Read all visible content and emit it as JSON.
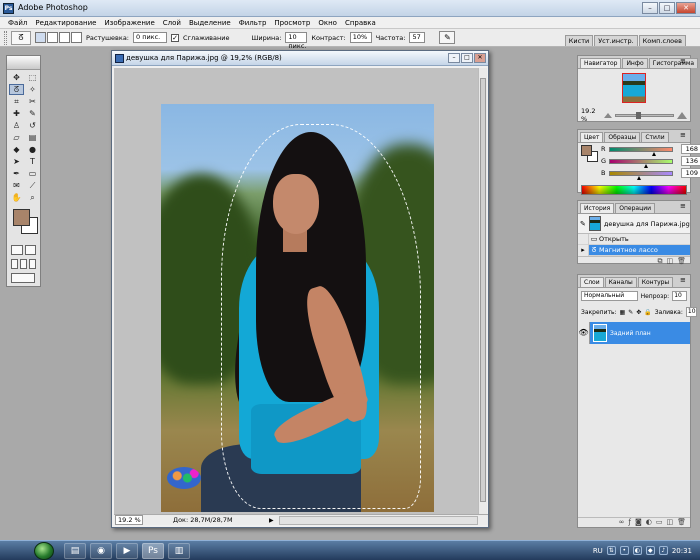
{
  "app": {
    "title": "Adobe Photoshop"
  },
  "menu": [
    "Файл",
    "Редактирование",
    "Изображение",
    "Слой",
    "Выделение",
    "Фильтр",
    "Просмотр",
    "Окно",
    "Справка"
  ],
  "options": {
    "feather_label": "Растушевка:",
    "feather_value": "0 пикс.",
    "antialias_label": "Сглаживание",
    "antialias_checked": true,
    "width_label": "Ширина:",
    "width_value": "10 пикс.",
    "contrast_label": "Контраст:",
    "contrast_value": "10%",
    "frequency_label": "Частота:",
    "frequency_value": "57"
  },
  "palette_well": [
    "Кисти",
    "Уст.инстр.",
    "Комп.слоев"
  ],
  "toolbox": {
    "foreground_color": "#a8846a",
    "background_color": "#ffffff",
    "tools": [
      "move-icon",
      "marquee-icon",
      "lasso-icon",
      "magic-wand-icon",
      "crop-icon",
      "slice-icon",
      "healing-icon",
      "brush-icon",
      "stamp-icon",
      "history-brush-icon",
      "eraser-icon",
      "gradient-icon",
      "blur-icon",
      "dodge-icon",
      "path-select-icon",
      "type-icon",
      "pen-icon",
      "shape-icon",
      "notes-icon",
      "eyedropper-icon",
      "hand-icon",
      "zoom-icon"
    ]
  },
  "document": {
    "title": "девушка для Парижа.jpg @ 19,2% (RGB/8)",
    "zoom": "19.2 %",
    "doc_info": "Док: 28,7M/28,7M"
  },
  "navigator": {
    "tabs": [
      "Навигатор",
      "Инфо",
      "Гистограмма"
    ],
    "zoom": "19.2 %",
    "slider_level": 0.35
  },
  "color": {
    "tabs": [
      "Цвет",
      "Образцы",
      "Стили"
    ],
    "r_label": "R",
    "r_value": "168",
    "g_label": "G",
    "g_value": "136",
    "b_label": "B",
    "b_value": "109"
  },
  "history": {
    "tabs": [
      "История",
      "Операции"
    ],
    "source": "девушка для Парижа.jpg",
    "steps": [
      "Открыть",
      "Магнитное лассо"
    ],
    "selected_step": 1
  },
  "layers": {
    "tabs": [
      "Слои",
      "Каналы",
      "Контуры"
    ],
    "blend_mode": "Нормальный",
    "opacity_label": "Непрозр:",
    "opacity_value": "10",
    "lock_label": "Закрепить:",
    "fill_label": "Заливка:",
    "fill_value": "10",
    "layer_name": "Задний план"
  },
  "taskbar": {
    "lang": "RU",
    "clock": "20:31"
  }
}
